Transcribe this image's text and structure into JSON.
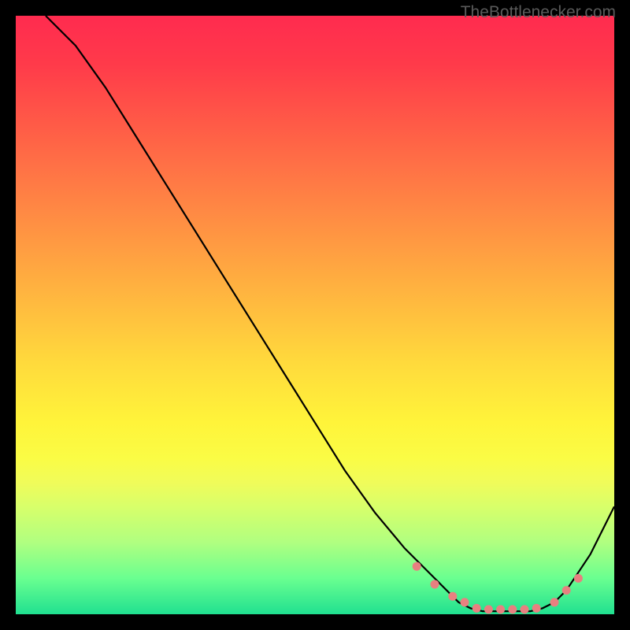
{
  "watermark": "TheBottlenecker.com",
  "chart_data": {
    "type": "line",
    "title": "",
    "xlabel": "",
    "ylabel": "",
    "xlim": [
      0,
      100
    ],
    "ylim": [
      0,
      100
    ],
    "series": [
      {
        "name": "curve",
        "x": [
          5,
          10,
          15,
          20,
          25,
          30,
          35,
          40,
          45,
          50,
          55,
          60,
          65,
          70,
          72,
          74,
          76,
          78,
          80,
          82,
          84,
          86,
          88,
          90,
          92,
          94,
          96,
          98,
          100
        ],
        "y": [
          100,
          95,
          88,
          80,
          72,
          64,
          56,
          48,
          40,
          32,
          24,
          17,
          11,
          6,
          4,
          2,
          1,
          0.5,
          0.5,
          0.5,
          0.5,
          0.5,
          1,
          2,
          4,
          7,
          10,
          14,
          18
        ]
      }
    ],
    "markers": {
      "name": "highlight-dots",
      "x": [
        67,
        70,
        73,
        75,
        77,
        79,
        81,
        83,
        85,
        87,
        90,
        92,
        94
      ],
      "y": [
        8,
        5,
        3,
        2,
        1,
        0.8,
        0.8,
        0.8,
        0.8,
        1,
        2,
        4,
        6
      ]
    },
    "background": "rainbow-vertical-gradient",
    "gradient_stops": [
      {
        "pos": 0,
        "color": "#ff2b4f"
      },
      {
        "pos": 50,
        "color": "#ffda3c"
      },
      {
        "pos": 100,
        "color": "#20e090"
      }
    ]
  }
}
